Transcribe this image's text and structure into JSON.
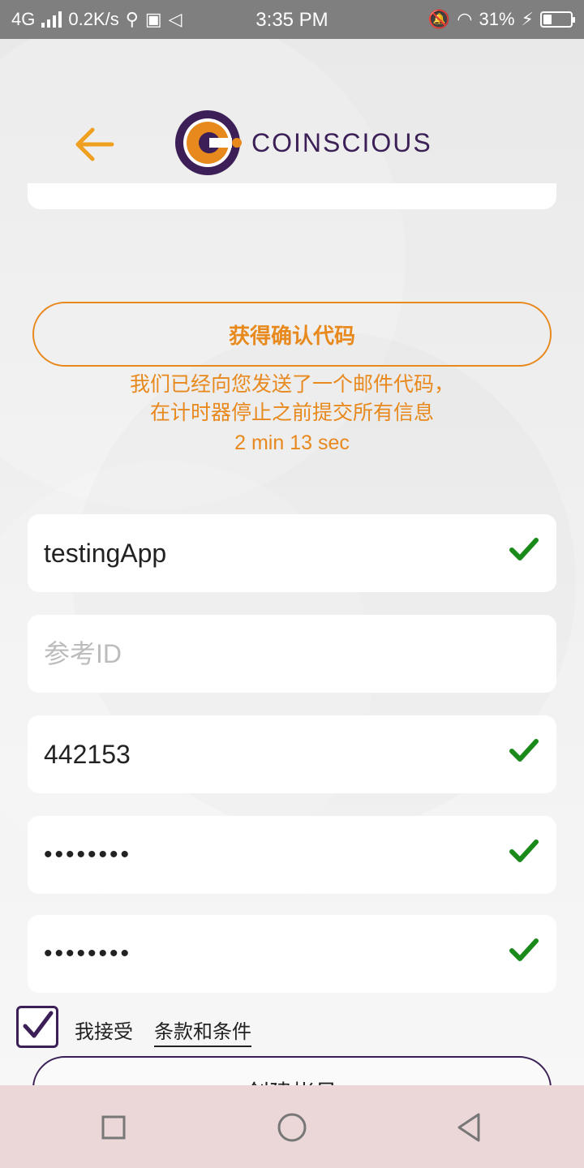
{
  "status_bar": {
    "network": "4G",
    "speed": "0.2K/s",
    "time": "3:35 PM",
    "battery": "31%",
    "battery_level": 0.31
  },
  "header": {
    "brand": "COINSCIOUS"
  },
  "code_section": {
    "button_label": "获得确认代码",
    "message_line1": "我们已经向您发送了一个邮件代码，",
    "message_line2": "在计时器停止之前提交所有信息",
    "timer": "2 min 13 sec"
  },
  "form": {
    "username": "testingApp",
    "reference_id_placeholder": "参考ID",
    "reference_id": "",
    "code": "442153",
    "password_mask": "••••••••",
    "confirm_password_mask": "••••••••"
  },
  "terms": {
    "accept_label": "我接受",
    "link_label": "条款和条件",
    "checked": true
  },
  "create_button": {
    "label": "创建帐号"
  },
  "colors": {
    "accent": "#e8891e",
    "brand": "#3b1f56",
    "check_green": "#1a8a1a"
  }
}
